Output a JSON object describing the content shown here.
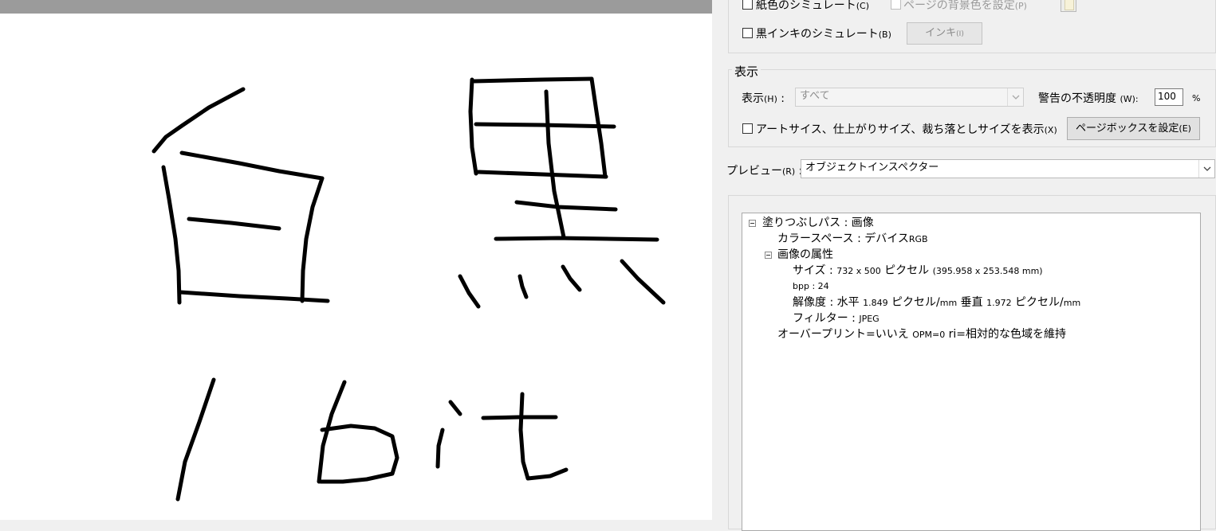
{
  "output_options": {
    "paper_color_sim_label": "紙色のシミュレート",
    "paper_color_sim_key": "(C)",
    "page_bg_label": "ページの背景色を設定",
    "page_bg_key": "(P)",
    "black_ink_sim_label": "黒インキのシミュレート",
    "black_ink_sim_key": "(B)",
    "ink_button_label": "インキ",
    "ink_button_key": "(I)"
  },
  "display_group": {
    "title": "表示",
    "show_label": "表示",
    "show_key": "(H)",
    "show_select_value": "すべて",
    "warning_opacity_label": "警告の不透明度",
    "warning_opacity_key": "(W):",
    "warning_opacity_value": "100",
    "percent_sign": "%",
    "art_trim_bleed_label": "アートサイス、仕上がりサイズ、裁ち落としサイズを表示",
    "art_trim_bleed_key": "(X)",
    "page_box_button": "ページボックスを設定",
    "page_box_key": "(E)"
  },
  "preview": {
    "label": "プレビュー",
    "key": "(R)",
    "select_value": "オブジェクトインスペクター"
  },
  "inspector": {
    "root_prefix": "塗りつぶしパス : 画像",
    "colorspace_prefix": "カラースペース : デバイス",
    "colorspace_value": "RGB",
    "attrs_label": "画像の属性",
    "size_prefix": "サイズ : ",
    "size_dims": "732 x 500",
    "size_unit": "ピクセル",
    "size_mm": "(395.958 x 253.548 mm)",
    "bpp": "bpp : 24",
    "res_prefix": "解像度 : 水平",
    "res_h": "1.849",
    "res_unit1": "ピクセル/",
    "res_mm1": "mm",
    "res_v_label": "垂直",
    "res_v": "1.972",
    "res_unit2": "ピクセル/",
    "res_mm2": "mm",
    "filter_prefix": "フィルター : ",
    "filter_value": "JPEG",
    "overprint_prefix": "オーバープリント=いいえ",
    "overprint_opm": "OPM=0",
    "overprint_ri": "ri=相対的な色域を維持"
  }
}
